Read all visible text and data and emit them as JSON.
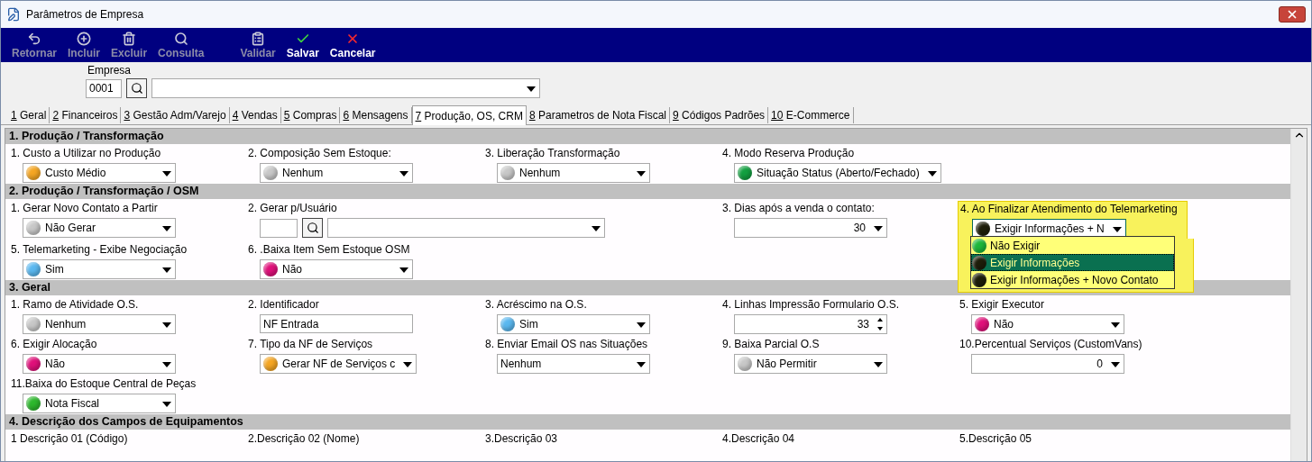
{
  "window": {
    "title": "Parâmetros de Empresa"
  },
  "toolbar": [
    {
      "kind": "back",
      "label": "Retornar",
      "disabled": true
    },
    {
      "kind": "add",
      "label": "Incluir",
      "disabled": true
    },
    {
      "kind": "delete",
      "label": "Excluir",
      "disabled": true
    },
    {
      "kind": "search",
      "label": "Consulta",
      "disabled": true
    },
    {
      "kind": "validate",
      "label": "Validar",
      "disabled": true
    },
    {
      "kind": "save",
      "label": "Salvar",
      "disabled": false
    },
    {
      "kind": "cancel",
      "label": "Cancelar",
      "disabled": false
    }
  ],
  "empresa": {
    "label": "Empresa",
    "code": "0001"
  },
  "tabs": [
    {
      "key": "1",
      "label": "Geral",
      "selected": false
    },
    {
      "key": "2",
      "label": "Financeiros",
      "selected": false
    },
    {
      "key": "3",
      "label": "Gestão Adm/Varejo",
      "selected": false
    },
    {
      "key": "4",
      "label": "Vendas",
      "selected": false
    },
    {
      "key": "5",
      "label": "Compras",
      "selected": false
    },
    {
      "key": "6",
      "label": "Mensagens",
      "selected": false
    },
    {
      "key": "7",
      "label": "Produção, OS, CRM",
      "selected": true
    },
    {
      "key": "8",
      "label": "Parametros de Nota Fiscal",
      "selected": false
    },
    {
      "key": "9",
      "label": "Códigos Padrões",
      "selected": false
    },
    {
      "key": "10",
      "label": "E-Commerce",
      "selected": false
    }
  ],
  "sections": [
    {
      "title": "1. Produção / Transformação",
      "rows": [
        {
          "cells": [
            {
              "kind": "combo",
              "label": "1. Custo a Utilizar no Produção",
              "value": "Custo Médio",
              "color": "#f5a623"
            },
            {
              "kind": "combo",
              "label": "2. Composição Sem Estoque:",
              "value": "Nenhum",
              "color": "#c8c8c8"
            },
            {
              "kind": "combo",
              "label": "3. Liberação Transformação",
              "value": "Nenhum",
              "color": "#c8c8c8"
            },
            {
              "kind": "combo",
              "label": "4. Modo Reserva Produção",
              "value": "Situação Status (Aberto/Fechado)",
              "color": "#12a040"
            }
          ]
        }
      ]
    },
    {
      "title": "2. Produção / Transformação / OSM",
      "rows": [
        {
          "cells": [
            {
              "kind": "combo",
              "label": "1. Gerar Novo Contato a Partir",
              "value": "Não Gerar",
              "color": "#c8c8c8"
            },
            {
              "kind": "lookup",
              "label": "2. Gerar p/Usuário"
            },
            {
              "kind": "number",
              "label": "3. Dias após a venda o contato:",
              "value": "30"
            },
            {
              "kind": "combo",
              "label": "4. Ao Finalizar Atendimento do Telemarketing",
              "value": "Exigir Informações + N",
              "color": "#1e1e0a",
              "highlighted": true,
              "open": true,
              "options": [
                {
                  "label": "Não Exigir",
                  "color": "#1db83a",
                  "selected": false
                },
                {
                  "label": "Exigir Informações",
                  "color": "#1e1e0a",
                  "selected": true
                },
                {
                  "label": "Exigir Informações + Novo Contato",
                  "color": "#1e1e0a",
                  "selected": false
                }
              ]
            }
          ]
        },
        {
          "cells": [
            {
              "kind": "combo",
              "label": "5. Telemarketing - Exibe Negociação",
              "value": "Sim",
              "color": "#5ab8f0"
            },
            {
              "kind": "combo",
              "label": "6. .Baixa Item Sem Estoque OSM",
              "value": "Não",
              "color": "#e0107a"
            }
          ]
        }
      ]
    },
    {
      "title": "3. Geral",
      "rows": [
        {
          "cells": [
            {
              "kind": "combo",
              "label": "1. Ramo de Atividade O.S.",
              "value": "Nenhum",
              "color": "#c8c8c8"
            },
            {
              "kind": "text",
              "label": "2. Identificador",
              "value": "NF Entrada"
            },
            {
              "kind": "combo",
              "label": "3. Acréscimo na O.S.",
              "value": "Sim",
              "color": "#5ab8f0"
            },
            {
              "kind": "spin",
              "label": "4. Linhas Impressão Formulario O.S.",
              "value": "33"
            },
            {
              "kind": "combo",
              "label": "5. Exigir Executor",
              "value": "Não",
              "color": "#e0107a"
            }
          ]
        },
        {
          "cells": [
            {
              "kind": "combo",
              "label": "6. Exigir Alocação",
              "value": "Não",
              "color": "#e0107a"
            },
            {
              "kind": "combo",
              "label": "7. Tipo da NF de Serviços",
              "value": "Gerar NF de Serviços c",
              "color": "#f5a623"
            },
            {
              "kind": "combo",
              "label": "8. Enviar Email OS nas Situações",
              "value": "Nenhum"
            },
            {
              "kind": "combo",
              "label": "9. Baixa Parcial O.S",
              "value": "Não Permitir",
              "color": "#c8c8c8"
            },
            {
              "kind": "number",
              "label": "10.Percentual Serviços (CustomVans)",
              "value": "0"
            }
          ]
        },
        {
          "cells": [
            {
              "kind": "combo",
              "label": "11.Baixa do Estoque Central de Peças",
              "value": "Nota Fiscal",
              "color": "#2db82d"
            }
          ]
        }
      ]
    },
    {
      "title": "4. Descrição dos Campos de Equipamentos",
      "rows": [
        {
          "cells": [
            {
              "kind": "caption",
              "label": "1 Descrição 01 (Código)"
            },
            {
              "kind": "caption",
              "label": "2.Descrição 02 (Nome)"
            },
            {
              "kind": "caption",
              "label": "3.Descrição 03"
            },
            {
              "kind": "caption",
              "label": "4.Descrição 04"
            },
            {
              "kind": "caption",
              "label": "5.Descrição 05"
            }
          ]
        }
      ]
    }
  ]
}
